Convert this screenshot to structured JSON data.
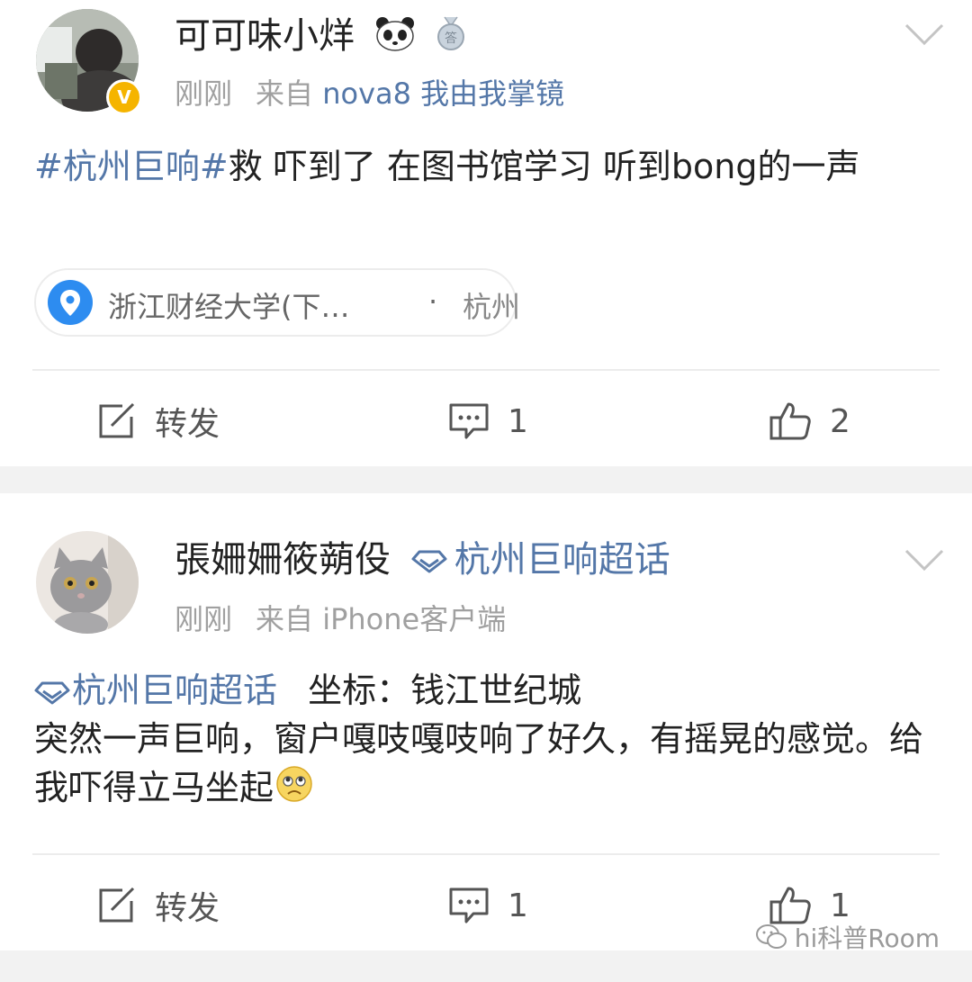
{
  "posts": [
    {
      "username": "可可味小烊",
      "time": "刚刚",
      "source_prefix": "来自",
      "source": "nova8 我由我掌镜",
      "content_hashtag": "#杭州巨响#",
      "content_text": "救 吓到了 在图书馆学习 听到bong的一声",
      "location_name": "浙江财经大学(下…",
      "location_sep": "·",
      "location_city": "杭州",
      "repost_label": "转发",
      "comment_count": "1",
      "like_count": "2"
    },
    {
      "username": "張姍姍筱蒴伇",
      "supertopic": "杭州巨响超话",
      "time": "刚刚",
      "source_prefix": "来自",
      "source": "iPhone客户端",
      "content_supertopic": "杭州巨响超话",
      "content_line1": "坐标：钱江世纪城",
      "content_text": "突然一声巨响，窗户嘎吱嘎吱响了好久，有摇晃的感觉。给我吓得立马坐起",
      "repost_label": "转发",
      "comment_count": "1",
      "like_count": "1"
    }
  ],
  "watermark": "hi科普Room",
  "colors": {
    "link": "#5477a8",
    "meta": "#a0a0a0",
    "verified": "#f5b400",
    "location_pin": "#2d8cf0"
  }
}
